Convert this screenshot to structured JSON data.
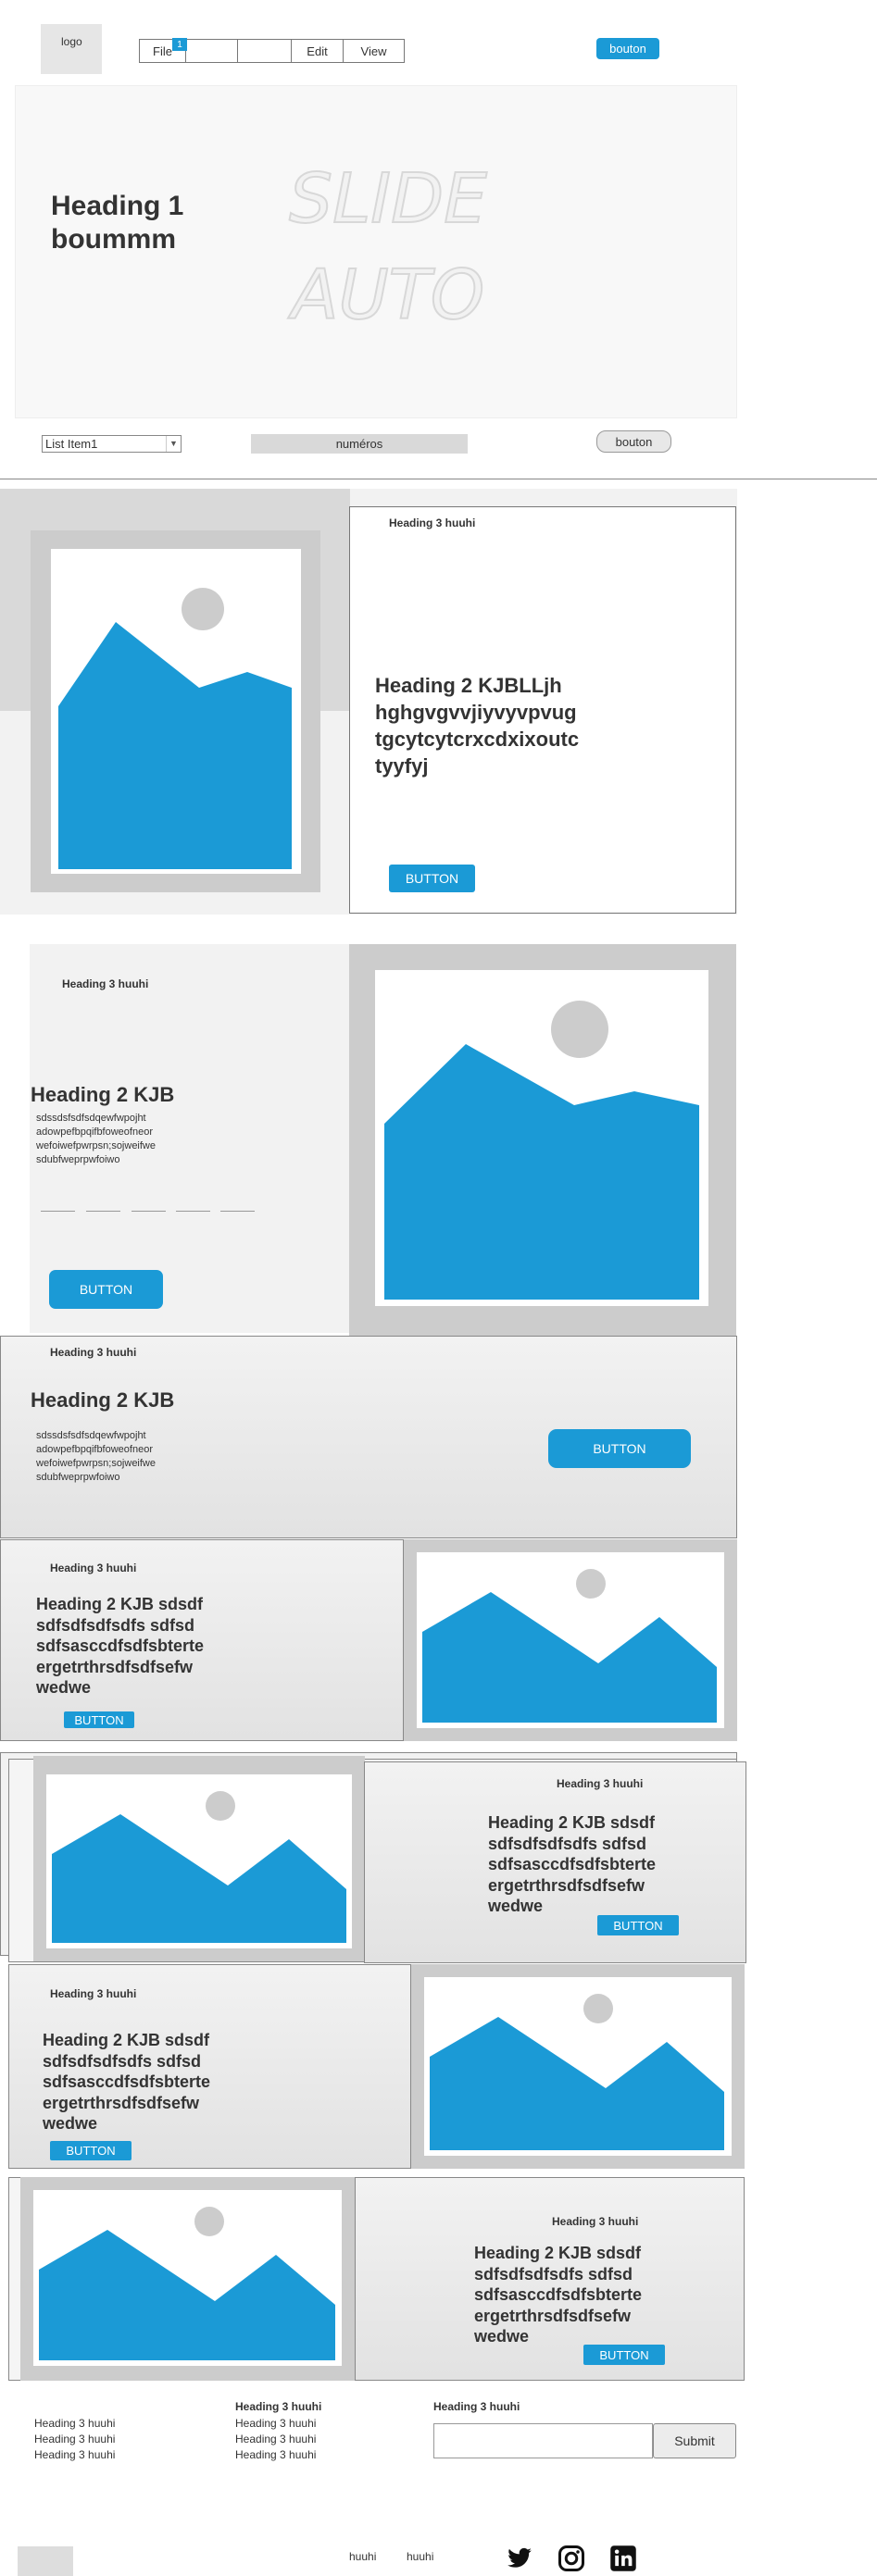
{
  "header": {
    "logo": "logo",
    "menu": [
      "File",
      "",
      "",
      "Edit",
      "View"
    ],
    "menu_badge": "1",
    "button": "bouton"
  },
  "hero": {
    "heading": [
      "Heading 1",
      "boummm"
    ],
    "slide_text": [
      "SLIDE",
      "AUTO"
    ]
  },
  "controls": {
    "list_value": "List Item1",
    "numbers_label": "numéros",
    "button": "bouton"
  },
  "section1": {
    "h3": "Heading 3 huuhi",
    "h2": [
      "Heading 2 KJBLLjh",
      "hghgvgvvjiyvyvpvug",
      "tgcytcytcrxcdxixoutc",
      "tyyfyj"
    ],
    "button": "BUTTON"
  },
  "section2": {
    "h3": "Heading 3 huuhi",
    "h2": "Heading 2 KJB",
    "body": [
      "sdssdsfsdfsdqewfwpojht",
      "adowpefbpqifbfoweofneor",
      "wefoiwefpwrpsn;sojweifwe",
      "sdubfweprpwfoiwo"
    ],
    "button": "BUTTON"
  },
  "section3": {
    "h3": "Heading 3 huuhi",
    "h2": "Heading 2 KJB",
    "body": [
      "sdssdsfsdfsdqewfwpojht",
      "adowpefbpqifbfoweofneor",
      "wefoiwefpwrpsn;sojweifwe",
      "sdubfweprpwfoiwo"
    ],
    "button": "BUTTON"
  },
  "card_text": {
    "h3": "Heading 3 huuhi",
    "h2": [
      "Heading 2 KJB sdsdf",
      "sdfsdfsdfsdfs sdfsd",
      "sdfsasccdfsdfsbterte",
      "ergetrthrsdfsdfsefw",
      "wedwe"
    ],
    "button": "BUTTON"
  },
  "footer": {
    "col1": [
      "Heading 3 huuhi",
      "Heading 3 huuhi",
      "Heading 3 huuhi"
    ],
    "col2_title": "Heading 3 huuhi",
    "col2": [
      "Heading 3 huuhi",
      "Heading 3 huuhi",
      "Heading 3 huuhi"
    ],
    "col3_title": "Heading 3 huuhi",
    "submit": "Submit",
    "links": [
      "huuhi",
      "huuhi"
    ]
  },
  "colors": {
    "accent": "#1b9ad6",
    "frame": "#cccccc",
    "panel": "#f2f2f2"
  }
}
